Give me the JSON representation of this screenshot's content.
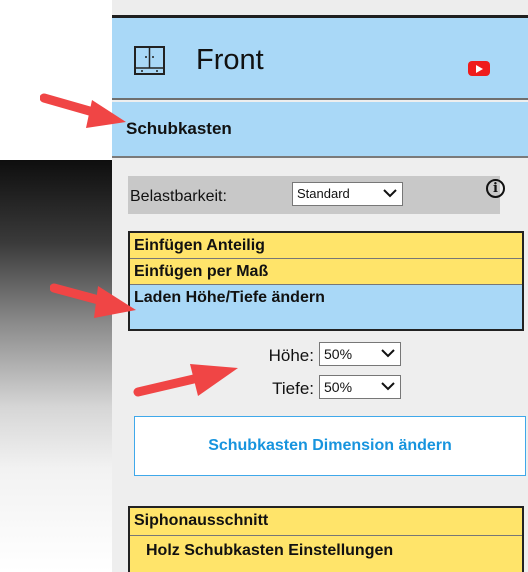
{
  "header": {
    "title": "Front",
    "icons": [
      "cabinet-icon",
      "youtube-icon"
    ],
    "colors": {
      "header_bg": "#a9d8f7",
      "youtube_red": "#ef1c1c"
    }
  },
  "section": {
    "title": "Schubkasten"
  },
  "load_capacity": {
    "label": "Belastbarkeit:",
    "selected": "Standard",
    "icon": "info-icon"
  },
  "menu": {
    "items": [
      {
        "label": "Einfügen Anteilig",
        "active": false
      },
      {
        "label": "Einfügen per Maß",
        "active": false
      },
      {
        "label": "Laden Höhe/Tiefe ändern",
        "active": true
      }
    ],
    "colors": {
      "item_bg": "#ffe46a",
      "active_bg": "#a9d8f7"
    }
  },
  "dimensions": {
    "height": {
      "label": "Höhe:",
      "selected": "50%"
    },
    "depth": {
      "label": "Tiefe:",
      "selected": "50%"
    },
    "button_label": "Schubkasten Dimension ändern",
    "button_color": "#1794de"
  },
  "bottom_menu": {
    "items": [
      {
        "label": "Siphonausschnitt"
      },
      {
        "label": "Holz Schubkasten Einstellungen"
      }
    ]
  },
  "annotations": {
    "arrow_color": "#f04545",
    "arrow_icon": "red-pointer-arrow-icon"
  }
}
